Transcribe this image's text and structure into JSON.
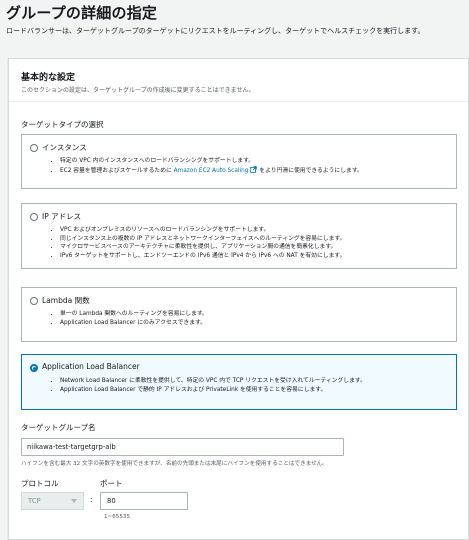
{
  "page": {
    "title": "グループの詳細の指定",
    "description": "ロードバランサーは、ターゲットグループのターゲットにリクエストをルーティングし、ターゲットでヘルスチェックを実行します。"
  },
  "basic_config": {
    "title": "基本的な設定",
    "subtitle": "このセクションの設定は、ターゲットグループの作成後に変更することはできません。",
    "target_type_label": "ターゲットタイプの選択",
    "options": [
      {
        "label": "インスタンス",
        "selected": false,
        "bullets": [
          "特定の VPC 内のインスタンスへのロードバランシングをサポートします。",
          "EC2 容量を管理およびスケールするために",
          "Amazon EC2 Auto Scaling",
          "をより円滑に使用できるようにします。"
        ]
      },
      {
        "label": "IP アドレス",
        "selected": false,
        "bullets": [
          "VPC およびオンプレミスのリソースへのロードバランシングをサポートします。",
          "同じインスタンス上の複数の IP アドレスとネットワークインターフェイスへのルーティングを容易にします。",
          "マイクロサービスベースのアーキテクチャに柔軟性を提供し、アプリケーション間の通信を簡素化します。",
          "IPv6 ターゲットをサポートし、エンドツーエンドの IPv6 通信と IPv4 から IPv6 への NAT を有効にします。"
        ]
      },
      {
        "label": "Lambda 関数",
        "selected": false,
        "bullets": [
          "単一の Lambda 関数へのルーティングを容易にします。",
          "Application Load Balancer にのみアクセスできます。"
        ]
      },
      {
        "label": "Application Load Balancer",
        "selected": true,
        "bullets": [
          "Network Load Balancer に柔軟性を提供して、特定の VPC 内で TCP リクエストを受け入れてルーティングします。",
          "Application Load Balancer で静的 IP アドレスおよび PrivateLink を使用することを容易にします。"
        ]
      }
    ],
    "target_group_name_label": "ターゲットグループ名",
    "target_group_name_value": "niikawa-test-targetgrp-alb",
    "target_group_name_hint": "ハイフンを含む最大 32 文字の英数字を使用できますが、名前の先頭または末尾にハイフンを使用することはできません。",
    "protocol_label": "プロトコル",
    "protocol_value": "TCP",
    "colon": ":",
    "port_label": "ポート",
    "port_value": "80",
    "port_range": "1~65535"
  },
  "colors": {
    "accent": "#0073bb",
    "border": "#aab7b8",
    "background": "#f2f3f3"
  },
  "icons": {
    "external_link": "external-link-icon"
  }
}
